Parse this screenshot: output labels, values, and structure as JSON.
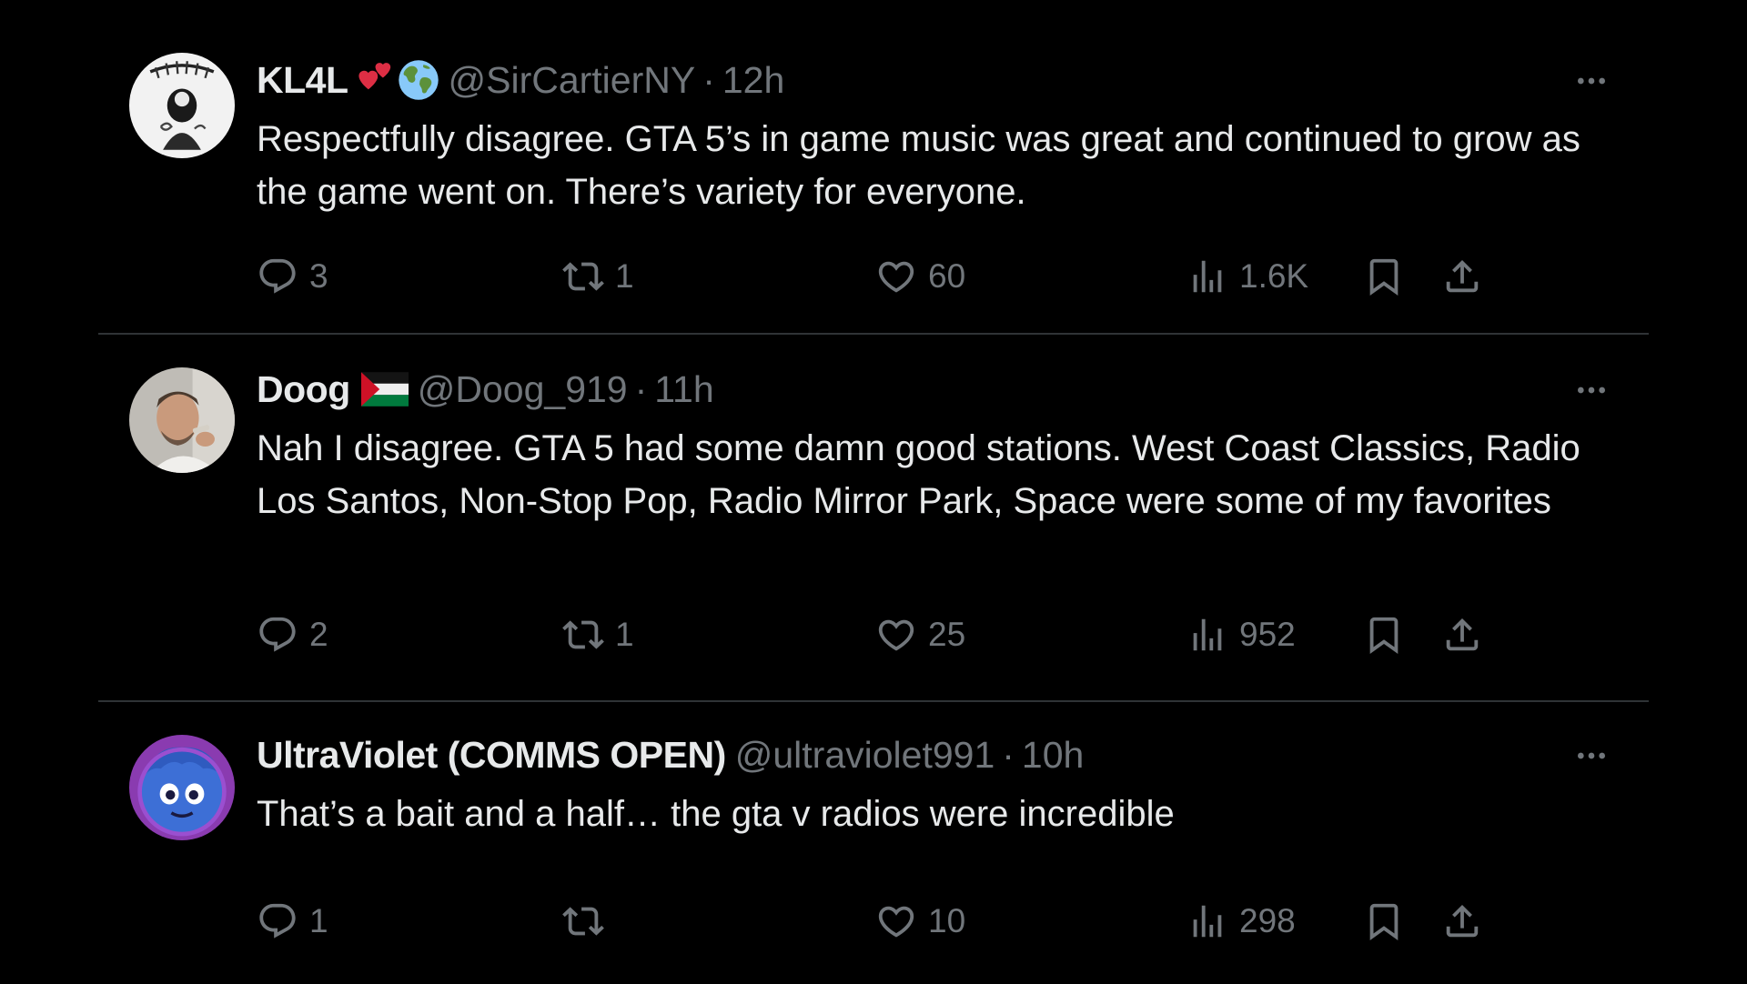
{
  "colors": {
    "background": "#000000",
    "text_primary": "#e7e9ea",
    "text_secondary": "#71767b",
    "divider": "#2f3336"
  },
  "icons": {
    "reply": "speech-bubble-icon",
    "retweet": "retweet-arrows-icon",
    "like": "heart-icon",
    "views": "bar-chart-icon",
    "bookmark": "bookmark-icon",
    "share": "upload-arrow-icon",
    "more": "ellipsis-icon"
  },
  "tweets": [
    {
      "display_name": "KL4L",
      "name_emojis": [
        "two-hearts-emoji",
        "globe-emoji"
      ],
      "handle": "@SirCartierNY",
      "separator": "·",
      "time": "12h",
      "text": "Respectfully disagree. GTA 5’s in game music was great and continued to grow as the game went on. There’s variety for everyone.",
      "stats": {
        "replies": "3",
        "retweets": "1",
        "likes": "60",
        "views": "1.6K"
      }
    },
    {
      "display_name": "Doog",
      "name_emojis": [
        "palestine-flag-emoji"
      ],
      "handle": "@Doog_919",
      "separator": "·",
      "time": "11h",
      "text": "Nah I disagree. GTA 5 had some damn good stations. West Coast Classics, Radio Los Santos, Non-Stop Pop, Radio Mirror Park, Space were some of my favorites",
      "stats": {
        "replies": "2",
        "retweets": "1",
        "likes": "25",
        "views": "952"
      }
    },
    {
      "display_name": "UltraViolet (COMMS OPEN)",
      "name_emojis": [],
      "handle": "@ultraviolet991",
      "separator": "·",
      "time": "10h",
      "text": "That’s a bait and a half… the gta v radios were incredible",
      "stats": {
        "replies": "1",
        "retweets": "",
        "likes": "10",
        "views": "298"
      }
    }
  ]
}
